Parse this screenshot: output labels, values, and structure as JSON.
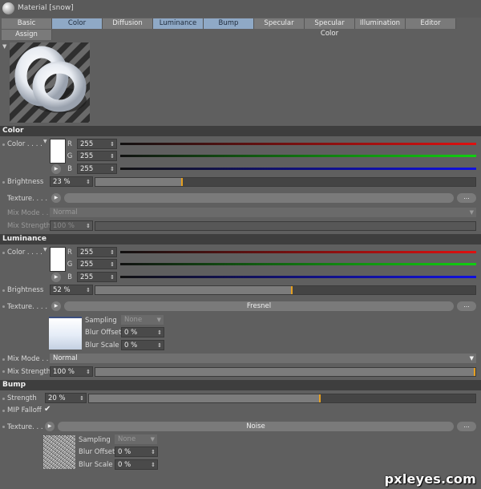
{
  "window": {
    "title": "Material [snow]"
  },
  "tabs": [
    {
      "label": "Basic",
      "active": false
    },
    {
      "label": "Color",
      "active": true
    },
    {
      "label": "Diffusion",
      "active": false
    },
    {
      "label": "Luminance",
      "active": true
    },
    {
      "label": "Bump",
      "active": true
    },
    {
      "label": "Specular",
      "active": false
    },
    {
      "label": "Specular Color",
      "active": false
    },
    {
      "label": "Illumination",
      "active": false
    },
    {
      "label": "Editor",
      "active": false
    },
    {
      "label": "Assign",
      "active": false
    }
  ],
  "color": {
    "heading": "Color",
    "color_label": "Color . . . .",
    "r_label": "R",
    "g_label": "G",
    "b_label": "B",
    "r_value": "255",
    "g_value": "255",
    "b_value": "255",
    "brightness_label": "Brightness",
    "brightness_value": "23 %",
    "brightness_level": 0.23,
    "texture_label": "Texture. . . .",
    "texture_name": "",
    "ellipsis": "...",
    "mix_mode_label": "Mix Mode . .",
    "mix_mode_value": "Normal",
    "mix_strength_label": "Mix Strength",
    "mix_strength_value": "100 %"
  },
  "luminance": {
    "heading": "Luminance",
    "color_label": "Color . . . .",
    "r_label": "R",
    "g_label": "G",
    "b_label": "B",
    "r_value": "255",
    "g_value": "255",
    "b_value": "255",
    "brightness_label": "Brightness",
    "brightness_value": "52 %",
    "brightness_level": 0.52,
    "texture_label": "Texture. . . .",
    "texture_name": "Fresnel",
    "ellipsis": "...",
    "sampling_label": "Sampling",
    "sampling_value": "None",
    "blur_offset_label": "Blur Offset",
    "blur_offset_value": "0 %",
    "blur_scale_label": "Blur Scale",
    "blur_scale_value": "0 %",
    "mix_mode_label": "Mix Mode . .",
    "mix_mode_value": "Normal",
    "mix_strength_label": "Mix Strength",
    "mix_strength_value": "100 %",
    "mix_strength_level": 1.0
  },
  "bump": {
    "heading": "Bump",
    "strength_label": "Strength",
    "strength_value": "20 %",
    "strength_level": 0.6,
    "mip_falloff_label": "MIP Falloff",
    "mip_falloff_check": "✔",
    "texture_label": "Texture. . . .",
    "texture_name": "Noise",
    "ellipsis": "...",
    "sampling_label": "Sampling",
    "sampling_value": "None",
    "blur_offset_label": "Blur Offset",
    "blur_offset_value": "0 %",
    "blur_scale_label": "Blur Scale",
    "blur_scale_value": "0 %"
  },
  "icons": {
    "material": "material-sphere-icon",
    "play": "play-arrow-icon",
    "dropdown": "chevron-down-icon",
    "spinner": "spinner-arrows-icon"
  },
  "colors": {
    "panel_bg": "#5f5f5f",
    "tab_active": "#8fa9c6",
    "slider_marker": "#e6a020",
    "red": "#e01010",
    "green": "#10d010",
    "blue": "#1010e0"
  },
  "watermark": "pxleyes.com"
}
